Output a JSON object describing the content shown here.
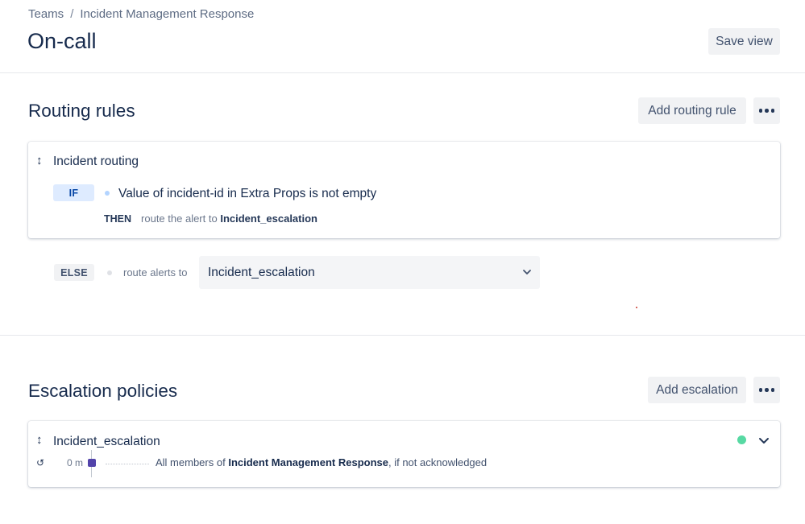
{
  "breadcrumb": {
    "items": [
      "Teams",
      "Incident Management Response"
    ],
    "separator": "/"
  },
  "page": {
    "title": "On-call",
    "save_view_label": "Save view"
  },
  "routing": {
    "title": "Routing rules",
    "add_label": "Add routing rule",
    "more_icon": "ellipsis-icon",
    "rule": {
      "drag_icon": "↕",
      "title": "Incident routing",
      "if_tag": "IF",
      "condition": "Value of incident-id in Extra Props is not empty",
      "then_tag": "THEN",
      "then_text": "route the alert to",
      "then_target": "Incident_escalation"
    },
    "else": {
      "tag": "ELSE",
      "text": "route alerts to",
      "selected": "Incident_escalation"
    }
  },
  "escalation": {
    "title": "Escalation policies",
    "add_label": "Add escalation",
    "more_icon": "ellipsis-icon",
    "policy": {
      "drag_icon": "↕",
      "title": "Incident_escalation",
      "status_color": "#57d9a3",
      "timeline_icon": "↺",
      "time": "0 m",
      "step_prefix": "All members of",
      "step_team": "Incident Management Response",
      "step_suffix": ", if not acknowledged"
    }
  },
  "colors": {
    "accent_square": "#5243aa",
    "status_green": "#57d9a3"
  }
}
